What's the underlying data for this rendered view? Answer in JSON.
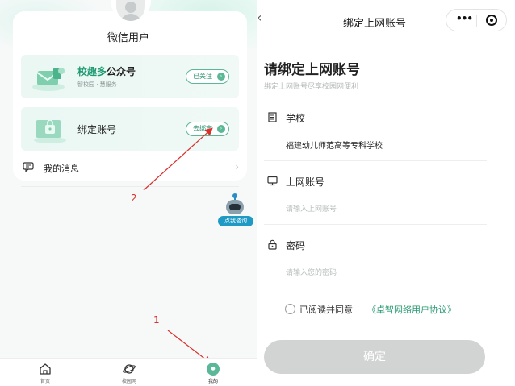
{
  "left": {
    "username": "微信用户",
    "card_official": {
      "title_accent": "校趣多",
      "title_rest": "公众号",
      "subtitle": "智校园 · 慧服务",
      "button": "已关注"
    },
    "card_bind": {
      "title": "绑定账号",
      "button": "去绑定"
    },
    "messages_label": "我的消息",
    "assistant_label": "点我咨询",
    "annotations": [
      "2",
      "1"
    ],
    "tabs": [
      {
        "label": "首页",
        "icon": "home-icon"
      },
      {
        "label": "校园网",
        "icon": "planet-icon"
      },
      {
        "label": "我的",
        "icon": "profile-dot-icon"
      }
    ]
  },
  "right": {
    "nav_title": "绑定上网账号",
    "heading": "请绑定上网账号",
    "subheading": "绑定上网账号尽享校园网便利",
    "school": {
      "label": "学校",
      "value": "福建幼儿师范高等专科学校"
    },
    "account": {
      "label": "上网账号",
      "placeholder": "请输入上网账号"
    },
    "password": {
      "label": "密码",
      "placeholder": "请输入您的密码"
    },
    "agree_text": "已阅读并同意",
    "agree_link": "《卓智网络用户协议》",
    "confirm_label": "确定"
  },
  "colors": {
    "accent_green": "#1f9a72",
    "link_green": "#2b9b73",
    "annotation_red": "#d9302b",
    "button_disabled": "#d2d3d3"
  }
}
